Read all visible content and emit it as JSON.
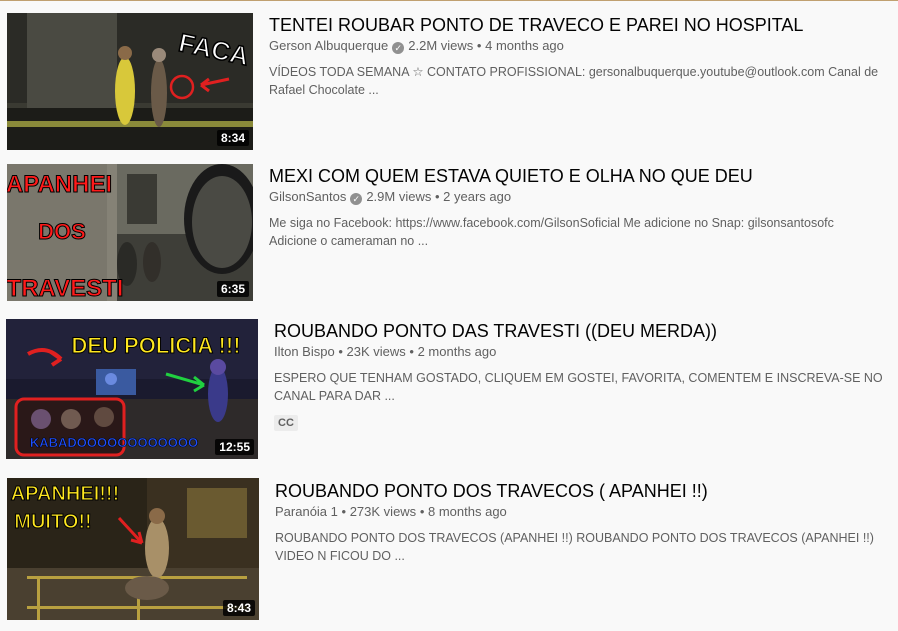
{
  "results": [
    {
      "title": "TENTEI ROUBAR PONTO DE TRAVECO E PAREI NO HOSPITAL",
      "channel": "Gerson Albuquerque",
      "verified": true,
      "views": "2.2M views",
      "age": "4 months ago",
      "description": "VÍDEOS TODA SEMANA ☆ CONTATO PROFISSIONAL: gersonalbuquerque.youtube@outlook.com Canal de Rafael Chocolate ...",
      "duration": "8:34",
      "thumb_text": [
        "FACA"
      ]
    },
    {
      "title": "MEXI COM QUEM ESTAVA QUIETO E OLHA NO QUE DEU",
      "channel": "GilsonSantos",
      "verified": true,
      "views": "2.9M views",
      "age": "2 years ago",
      "description": "Me siga no Facebook: https://www.facebook.com/GilsonSoficial Me adicione no Snap: gilsonsantosofc Adicione o cameraman no ...",
      "duration": "6:35",
      "thumb_text": [
        "APANHEI",
        "DOS",
        "TRAVESTI"
      ]
    },
    {
      "title": "ROUBANDO PONTO DAS TRAVESTI ((DEU MERDA))",
      "channel": "Ilton Bispo",
      "verified": false,
      "views": "23K views",
      "age": "2 months ago",
      "description": "ESPERO QUE TENHAM GOSTADO, CLIQUEM EM GOSTEI, FAVORITA, COMENTEM E INSCREVA-SE NO CANAL PARA DAR ...",
      "duration": "12:55",
      "badge": "CC",
      "thumb_text": [
        "DEU POLICIA !!!",
        "KABADOOOOOOOOOOOO"
      ]
    },
    {
      "title": "ROUBANDO PONTO DOS TRAVECOS ( APANHEI !!)",
      "channel": "Paranóia 1",
      "verified": false,
      "views": "273K views",
      "age": "8 months ago",
      "description": "ROUBANDO PONTO DOS TRAVECOS (APANHEI !!) ROUBANDO PONTO DOS TRAVECOS (APANHEI !!) VIDEO N FICOU DO ...",
      "duration": "8:43",
      "thumb_text": [
        "APANHEI!!!",
        "MUITO!!"
      ]
    }
  ],
  "separator": "•"
}
